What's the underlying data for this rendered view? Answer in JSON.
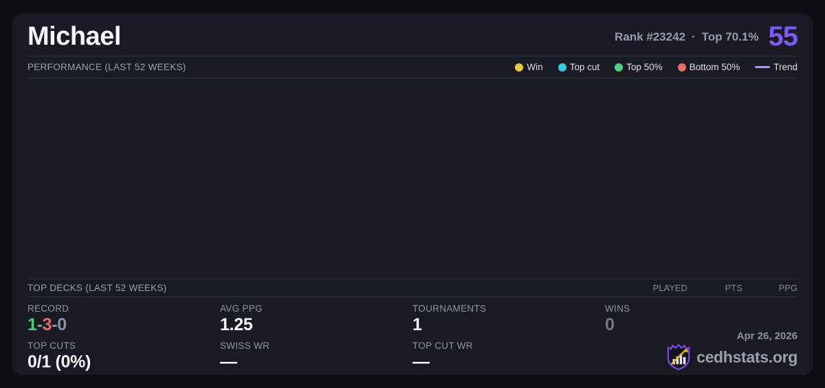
{
  "player": {
    "name": "Michael",
    "rank_label": "Rank #23242",
    "rank_separator": "·",
    "percentile_label": "Top 70.1%",
    "score": "55",
    "score_color": "#7d5bee"
  },
  "performance": {
    "title": "PERFORMANCE (LAST 52 WEEKS)",
    "legend": [
      {
        "label": "Win",
        "color": "#edc63e",
        "marker": "dot"
      },
      {
        "label": "Top cut",
        "color": "#35c7e6",
        "marker": "dot"
      },
      {
        "label": "Top 50%",
        "color": "#4bd07f",
        "marker": "dot"
      },
      {
        "label": "Bottom 50%",
        "color": "#ee6a6a",
        "marker": "dot"
      },
      {
        "label": "Trend",
        "color": "#a79af0",
        "marker": "line"
      }
    ]
  },
  "top_decks": {
    "title": "TOP DECKS (LAST 52 WEEKS)",
    "columns": [
      "PLAYED",
      "PTS",
      "PPG"
    ],
    "rows": []
  },
  "stats": {
    "record": {
      "label": "RECORD",
      "wins": "1",
      "losses": "3",
      "draws": "0",
      "separator": "-"
    },
    "avg_ppg": {
      "label": "AVG PPG",
      "value": "1.25"
    },
    "tournaments": {
      "label": "TOURNAMENTS",
      "value": "1"
    },
    "wins": {
      "label": "WINS",
      "value": "0"
    },
    "top_cuts": {
      "label": "TOP CUTS",
      "value": "0/1 (0%)"
    },
    "swiss_wr": {
      "label": "SWISS WR",
      "value": "—"
    },
    "top_cut_wr": {
      "label": "TOP CUT WR",
      "value": "—"
    }
  },
  "footer": {
    "date": "Apr 26, 2026",
    "brand": "cedhstats.org"
  }
}
